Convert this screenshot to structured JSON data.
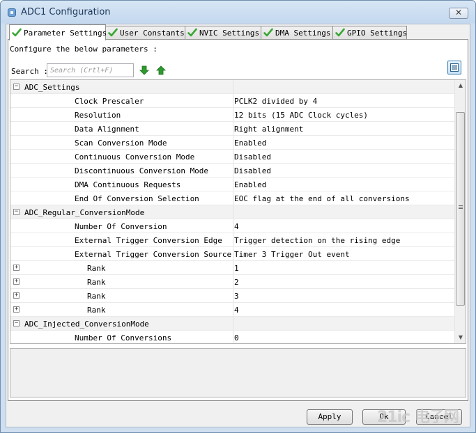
{
  "window": {
    "title": "ADC1 Configuration"
  },
  "tabs": [
    {
      "label": "Parameter Settings",
      "active": true
    },
    {
      "label": "User Constants"
    },
    {
      "label": "NVIC Settings"
    },
    {
      "label": "DMA Settings"
    },
    {
      "label": "GPIO Settings"
    }
  ],
  "panel": {
    "instructions": "Configure the below parameters :",
    "search_label": "Search :",
    "search_placeholder": "Search (Crtl+F)"
  },
  "rows": [
    {
      "type": "group",
      "expander": "−",
      "name": "ADC_Settings",
      "value": ""
    },
    {
      "type": "param",
      "name": "Clock Prescaler",
      "value": "PCLK2 divided by 4"
    },
    {
      "type": "param",
      "name": "Resolution",
      "value": "12 bits (15 ADC Clock cycles)"
    },
    {
      "type": "param",
      "name": "Data Alignment",
      "value": "Right alignment"
    },
    {
      "type": "param",
      "name": "Scan Conversion Mode",
      "value": "Enabled"
    },
    {
      "type": "param",
      "name": "Continuous Conversion Mode",
      "value": "Disabled"
    },
    {
      "type": "param",
      "name": "Discontinuous Conversion Mode",
      "value": "Disabled"
    },
    {
      "type": "param",
      "name": "DMA Continuous Requests",
      "value": "Enabled"
    },
    {
      "type": "param",
      "name": "End Of Conversion Selection",
      "value": "EOC flag at the end of all conversions"
    },
    {
      "type": "group",
      "expander": "−",
      "name": "ADC_Regular_ConversionMode",
      "value": ""
    },
    {
      "type": "param",
      "name": "Number Of Conversion",
      "value": "4"
    },
    {
      "type": "param",
      "name": "External Trigger Conversion Edge",
      "value": "Trigger detection on the rising edge"
    },
    {
      "type": "param",
      "name": "External Trigger Conversion Source",
      "value": "Timer 3 Trigger Out event"
    },
    {
      "type": "rank",
      "expander": "+",
      "name": "Rank",
      "value": "1"
    },
    {
      "type": "rank",
      "expander": "+",
      "name": "Rank",
      "value": "2"
    },
    {
      "type": "rank",
      "expander": "+",
      "name": "Rank",
      "value": "3"
    },
    {
      "type": "rank",
      "expander": "+",
      "name": "Rank",
      "value": "4"
    },
    {
      "type": "group",
      "expander": "−",
      "name": "ADC_Injected_ConversionMode",
      "value": ""
    },
    {
      "type": "param",
      "name": "Number Of Conversions",
      "value": "0"
    }
  ],
  "buttons": {
    "apply": "Apply",
    "ok": "Ok",
    "cancel": "Cancel"
  },
  "watermark": "21ic 电子网",
  "colors": {
    "check_green": "#3aa635",
    "arrow_green": "#2e9b2e"
  }
}
